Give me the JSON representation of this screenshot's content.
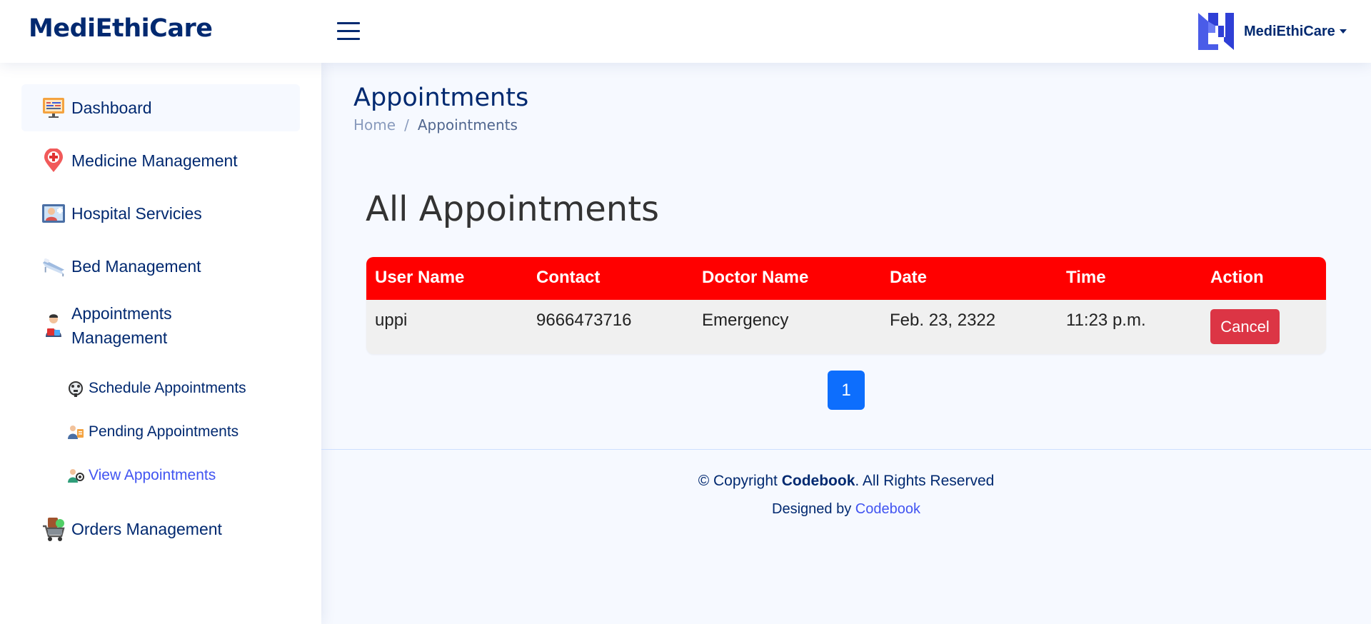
{
  "header": {
    "brand": "MediEthiCare",
    "profile_name": "MediEthiCare"
  },
  "sidebar": {
    "items": [
      {
        "label": "Dashboard",
        "icon": "dashboard-icon"
      },
      {
        "label": "Medicine Management",
        "icon": "medicine-pin-icon"
      },
      {
        "label": "Hospital Servicies",
        "icon": "hospital-service-icon"
      },
      {
        "label": "Bed Management",
        "icon": "bed-icon"
      },
      {
        "label": "Appointments\nManagement",
        "label_line1": "Appointments",
        "label_line2": "Management",
        "icon": "appointment-doctor-icon"
      },
      {
        "label": "Orders Management",
        "icon": "shopping-cart-icon"
      }
    ],
    "sub_items": [
      {
        "label": "Schedule Appointments",
        "icon": "schedule-icon"
      },
      {
        "label": "Pending Appointments",
        "icon": "pending-icon"
      },
      {
        "label": "View Appointments",
        "icon": "view-icon"
      }
    ]
  },
  "main": {
    "page_title": "Appointments",
    "breadcrumb": {
      "home": "Home",
      "separator": "/",
      "current": "Appointments"
    },
    "section_title": "All Appointments",
    "table": {
      "headers": [
        "User Name",
        "Contact",
        "Doctor Name",
        "Date",
        "Time",
        "Action"
      ],
      "rows": [
        {
          "user_name": "uppi",
          "contact": "9666473716",
          "doctor_name": "Emergency",
          "date": "Feb. 23, 2322",
          "time": "11:23 p.m.",
          "action": "Cancel"
        }
      ]
    },
    "pagination": {
      "current_page": "1"
    }
  },
  "footer": {
    "copyright_prefix": "© Copyright ",
    "copyright_brand": "Codebook",
    "copyright_suffix": ". All Rights Reserved",
    "designed_by": "Designed by ",
    "designer": "Codebook"
  },
  "colors": {
    "primary": "#012970",
    "accent": "#4154f1",
    "table_header": "#ff0000",
    "danger": "#dc3545",
    "page_button": "#0d6efd"
  }
}
